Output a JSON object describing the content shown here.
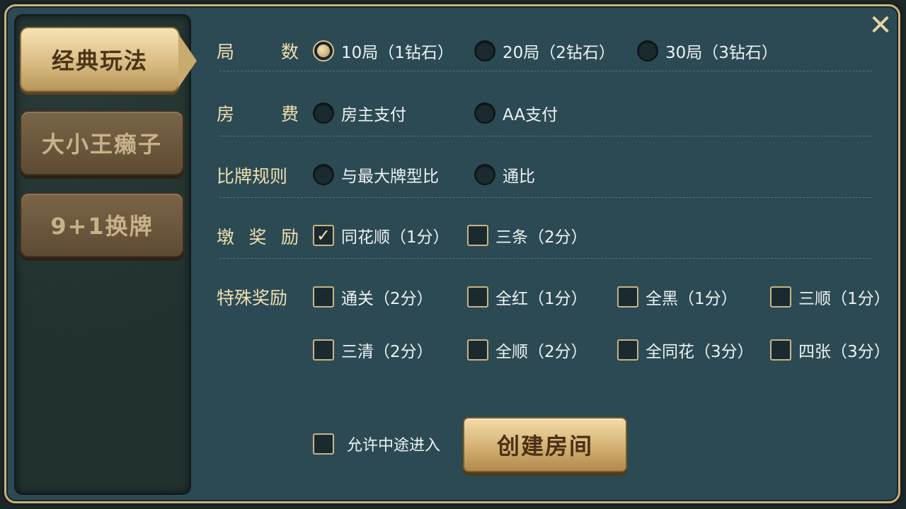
{
  "tabs": [
    {
      "label": "经典玩法",
      "active": true
    },
    {
      "label": "大小王癞子",
      "active": false
    },
    {
      "label": "9+1换牌",
      "active": false
    }
  ],
  "close_icon": "close-icon",
  "rows": {
    "rounds": {
      "label_chars": [
        "局",
        "数"
      ],
      "options": [
        "10局（1钻石）",
        "20局（2钻石）",
        "30局（3钻石）"
      ],
      "selected": 0
    },
    "fee": {
      "label_chars": [
        "房",
        "费"
      ],
      "options": [
        "房主支付",
        "AA支付"
      ]
    },
    "compare": {
      "label": "比牌规则",
      "options": [
        "与最大牌型比",
        "通比"
      ]
    },
    "bonus": {
      "label_chars": [
        "墩",
        "奖",
        "励"
      ],
      "options": [
        "同花顺（1分）",
        "三条（2分）"
      ],
      "checked": [
        true,
        false
      ]
    },
    "special": {
      "label": "特殊奖励",
      "options": [
        "通关（2分）",
        "全红（1分）",
        "全黑（1分）",
        "三顺（1分）",
        "三清（2分）",
        "全顺（2分）",
        "全同花（3分）",
        "四张（3分）"
      ]
    }
  },
  "allow_join": "允许中途进入",
  "create_button": "创建房间",
  "colors": {
    "accent_gold": "#d9bd83",
    "panel": "#2b4a54"
  }
}
